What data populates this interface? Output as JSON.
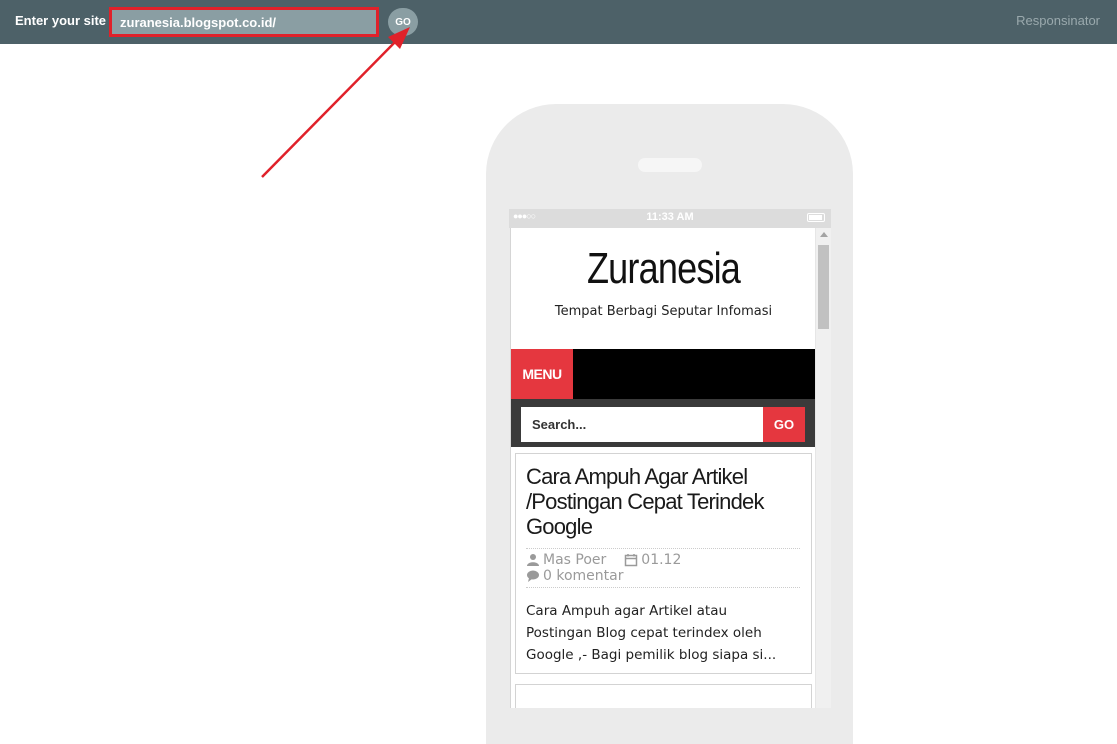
{
  "topbar": {
    "label": "Enter your site",
    "url_value": "zuranesia.blogspot.co.id/",
    "go_label": "GO",
    "brand": "Responsinator"
  },
  "phone": {
    "status_time": "11:33 AM",
    "status_dots": "●●●○○"
  },
  "site": {
    "title": "Zuranesia",
    "tagline": "Tempat Berbagi Seputar Infomasi",
    "menu_label": "MENU",
    "search_placeholder": "Search...",
    "search_go": "GO"
  },
  "post": {
    "title": "Cara Ampuh Agar Artikel /Postingan Cepat Terindek Google",
    "author": "Mas Poer",
    "date": "01.12",
    "comments": "0 komentar",
    "excerpt": "Cara Ampuh agar Artikel atau\nPostingan Blog cepat terindex oleh\nGoogle ,- Bagi pemilik blog siapa si..."
  },
  "colors": {
    "topbar_bg": "#4d6168",
    "highlight_red": "#e0212a",
    "accent_red": "#e5373f"
  },
  "icons": {
    "author": "user-icon",
    "date": "calendar-icon",
    "comments": "comment-icon"
  }
}
